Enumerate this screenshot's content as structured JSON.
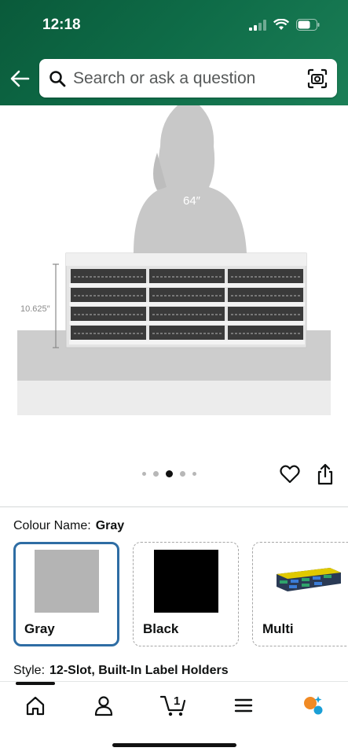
{
  "status_bar": {
    "time": "12:18"
  },
  "search": {
    "placeholder": "Search or ask a question"
  },
  "product": {
    "height_label": "64″",
    "depth_label": "10.625″",
    "image_count": 5,
    "active_image_index": 2
  },
  "colour": {
    "label": "Colour Name:",
    "selected": "Gray",
    "options": [
      {
        "name": "Gray",
        "color": "#b4b4b4",
        "selected": true
      },
      {
        "name": "Black",
        "color": "#000000",
        "selected": false
      },
      {
        "name": "Multi",
        "color": "multicolor",
        "selected": false
      }
    ]
  },
  "style": {
    "label": "Style:",
    "value": "12-Slot, Built-In Label Holders"
  },
  "bottom_nav": {
    "cart_count": "1",
    "items": [
      "home-icon",
      "account-icon",
      "cart-icon",
      "menu-icon",
      "rufus-icon"
    ]
  },
  "theme": {
    "header_green": "#0e6b47",
    "selected_border": "#2e6da4"
  }
}
